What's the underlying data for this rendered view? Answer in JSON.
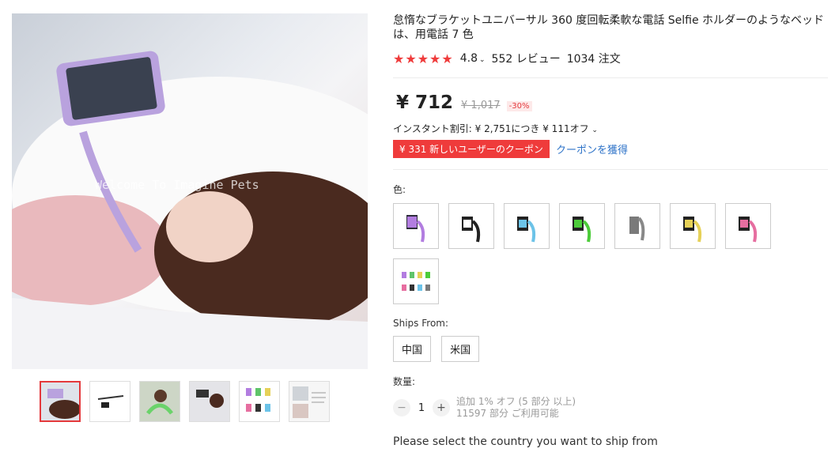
{
  "product": {
    "title": "怠惰なブラケットユニバーサル 360 度回転柔軟な電話 Selfie ホルダーのようなベッドは、用電話 7 色",
    "rating": "4.8",
    "reviews": "552 レビュー",
    "orders": "1034 注文",
    "price": "¥ 712",
    "original_price": "¥ 1,017",
    "discount": "-30%",
    "instant_discount": "インスタント割引: ¥ 2,751につき ¥ 111オフ",
    "coupon_badge": "¥ 331 新しいユーザーのクーポン",
    "coupon_link": "クーポンを獲得",
    "watermark": "Welcome To Imagine Pets"
  },
  "color_label": "色:",
  "colors": [
    "purple",
    "black",
    "blue",
    "green",
    "gray",
    "yellow",
    "pink",
    "mixed"
  ],
  "ships_from": {
    "label": "Ships From:",
    "options": [
      "中国",
      "米国"
    ]
  },
  "quantity": {
    "label": "数量:",
    "value": "1",
    "minus": "−",
    "plus": "+",
    "note1": "追加 1% オフ (5 部分 以上)",
    "note2": "11597 部分 ご利用可能"
  },
  "ship_notice": "Please select the country you want to ship from",
  "accent_color": "#ef3b3b"
}
